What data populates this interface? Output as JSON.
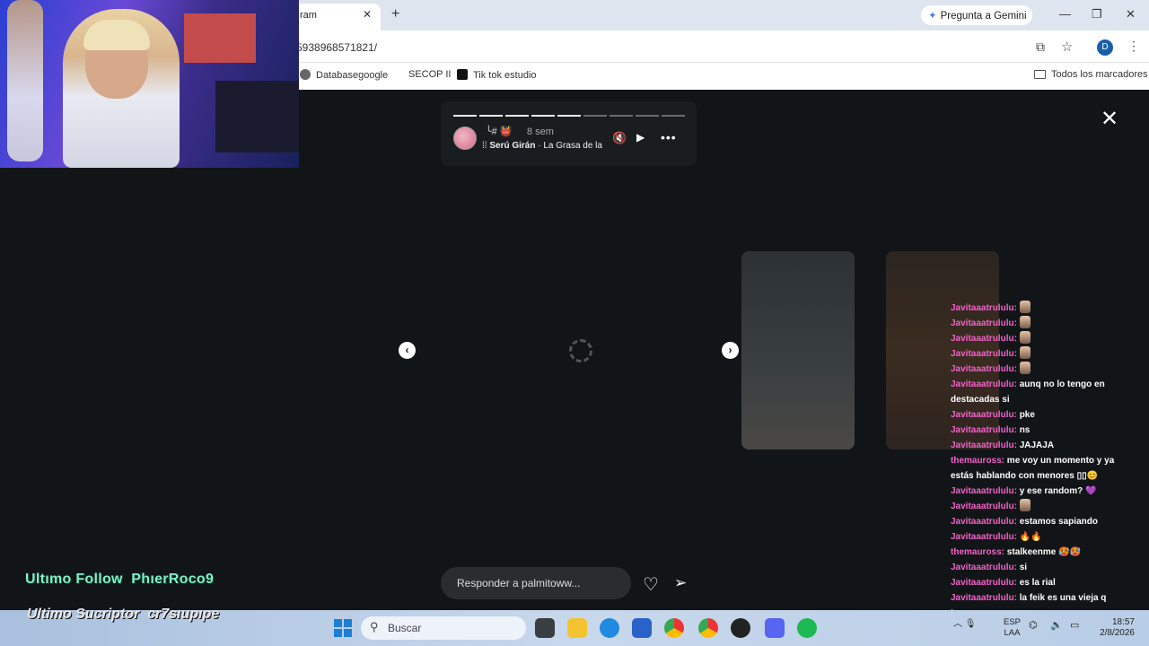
{
  "browser": {
    "tab_title": "ram",
    "tab_close": "✕",
    "new_tab": "+",
    "gemini_label": "Pregunta a Gemini",
    "url": "5938968571821/",
    "window_controls": [
      "—",
      "❐",
      "✕"
    ],
    "profile_initial": "D",
    "bookmarks": [
      "Databasegoogle",
      "SECOP II",
      "Tik tok estudio"
    ],
    "all_bookmarks": "Todos los marcadores"
  },
  "story": {
    "segments_total": 9,
    "segments_done": 5,
    "user": "╰# 👹",
    "time": "8 sem",
    "music_artist": "Serú Girán",
    "music_track": " · La Grasa de las Capitales",
    "reply_placeholder": "Responder a palmitoww...",
    "icons": {
      "mute": "mute-icon",
      "play": "play-icon",
      "more": "more-icon",
      "close": "close-icon",
      "prev": "chevron-left-icon",
      "next": "chevron-right-icon",
      "like": "heart-icon",
      "send": "send-icon"
    }
  },
  "chat": [
    {
      "user": "Javitaaatrululu:",
      "text": "",
      "emote": true
    },
    {
      "user": "Javitaaatrululu:",
      "text": "",
      "emote": true
    },
    {
      "user": "Javitaaatrululu:",
      "text": "",
      "emote": true
    },
    {
      "user": "Javitaaatrululu:",
      "text": "",
      "emote": true
    },
    {
      "user": "Javitaaatrululu:",
      "text": "",
      "emote": true
    },
    {
      "user": "Javitaaatrululu:",
      "text": "aunq no lo tengo en destacadas si",
      "emote": false
    },
    {
      "user": "Javitaaatrululu:",
      "text": "pke",
      "emote": false
    },
    {
      "user": "Javitaaatrululu:",
      "text": "ns",
      "emote": false
    },
    {
      "user": "Javitaaatrululu:",
      "text": "JAJAJA",
      "emote": false
    },
    {
      "user": "themauross:",
      "text": "me voy un momento y ya estás hablando con menores ▯▯😊",
      "emote": false
    },
    {
      "user": "Javitaaatrululu:",
      "text": "y ese random? 💜",
      "emote": false
    },
    {
      "user": "Javitaaatrululu:",
      "text": "",
      "emote": true
    },
    {
      "user": "Javitaaatrululu:",
      "text": "estamos sapiando",
      "emote": false
    },
    {
      "user": "Javitaaatrululu:",
      "text": "🔥🔥",
      "emote": false
    },
    {
      "user": "themauross:",
      "text": "stalkeenme 🥵🥵",
      "emote": false
    },
    {
      "user": "Javitaaatrululu:",
      "text": "si",
      "emote": false
    },
    {
      "user": "Javitaaatrululu:",
      "text": "es la rial",
      "emote": false
    },
    {
      "user": "Javitaaatrululu:",
      "text": "la feik es una vieja q tengo",
      "emote": false
    }
  ],
  "overlay": {
    "follow_label": "Ultımo Follow",
    "follow_name": "PhıerRoco9",
    "sub_label": "Ultimo Sucriptor",
    "sub_name": "cr7sıupıpe"
  },
  "taskbar": {
    "search_placeholder": "Buscar",
    "lang_1": "ESP",
    "lang_2": "LAA",
    "time": "18:57",
    "date": "2/8/2026"
  },
  "colors": {
    "chat_user": "#f262c8",
    "follow_text": "#7ef0c7",
    "viewer_bg": "#121517"
  }
}
